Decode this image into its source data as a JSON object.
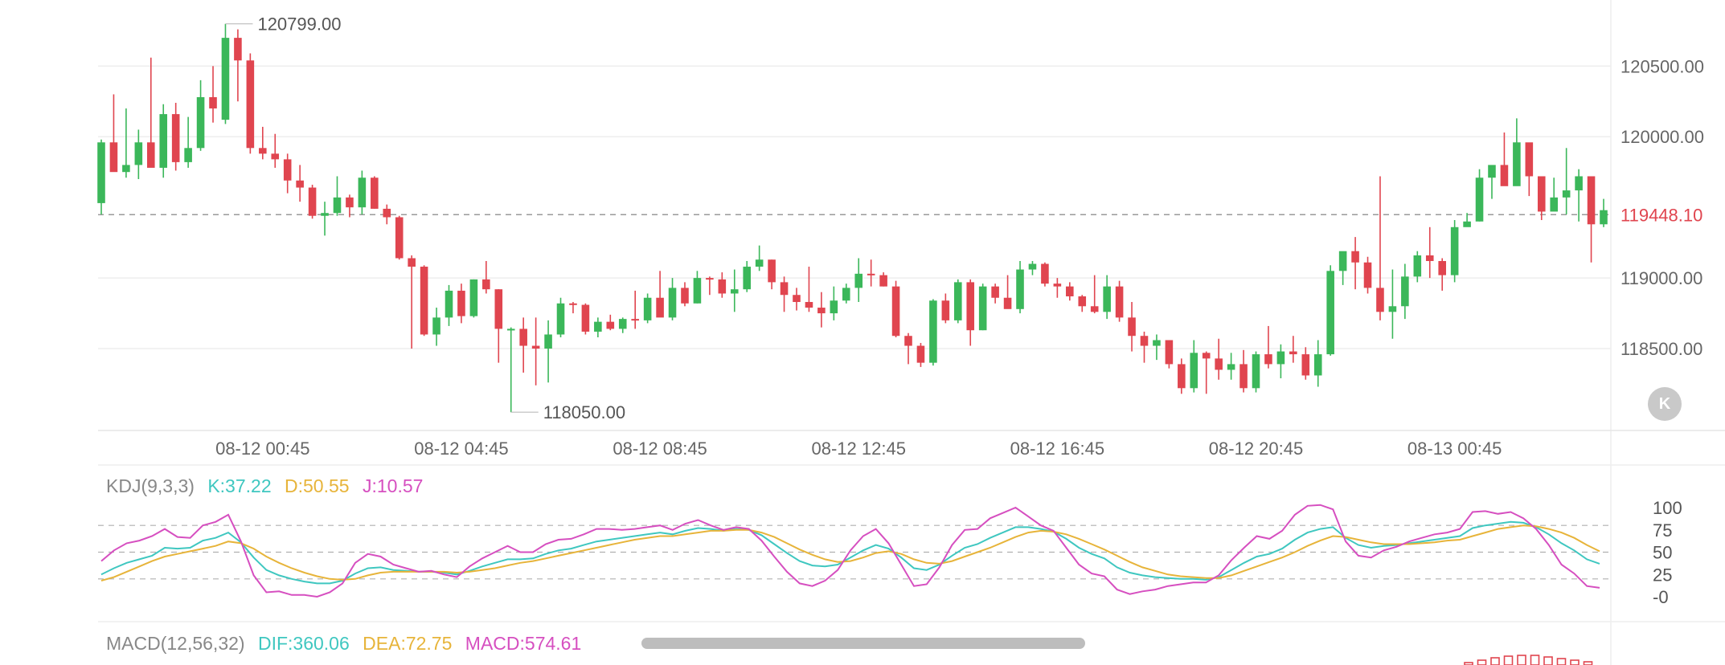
{
  "colors": {
    "up": "#3bb75a",
    "down": "#e0454f",
    "k_line": "#3fc7c0",
    "d_line": "#e7b43a",
    "j_line": "#d64fc0",
    "grid": "#eeeeee",
    "text": "#666666",
    "price_tag": "#e0454f"
  },
  "k_button": {
    "label": "K"
  },
  "chart_data": [
    {
      "type": "candlestick",
      "title": "",
      "ylim": [
        118000,
        120820
      ],
      "y_ticks": [
        "120500.00",
        "120000.00",
        "119000.00",
        "118500.00"
      ],
      "y_tick_values": [
        120500,
        120000,
        119000,
        118500
      ],
      "x_ticks": [
        "08-12 00:45",
        "08-12 04:45",
        "08-12 08:45",
        "08-12 12:45",
        "08-12 16:45",
        "08-12 20:45",
        "08-13 00:45"
      ],
      "x_tick_index": [
        13,
        29,
        45,
        61,
        77,
        93,
        109
      ],
      "current_price": {
        "label": "119448.10",
        "value": 119448.1
      },
      "annotations": [
        {
          "label": "120799.00",
          "value": 120799,
          "index": 10
        },
        {
          "label": "118050.00",
          "value": 118050,
          "index": 33
        }
      ],
      "ohlc": [
        [
          119530,
          119980,
          119450,
          119960
        ],
        [
          119960,
          120300,
          119760,
          119750
        ],
        [
          119750,
          120200,
          119710,
          119800
        ],
        [
          119800,
          120050,
          119700,
          119960
        ],
        [
          119960,
          120560,
          119800,
          119780
        ],
        [
          119780,
          120230,
          119710,
          120160
        ],
        [
          120160,
          120240,
          119760,
          119820
        ],
        [
          119820,
          120140,
          119780,
          119920
        ],
        [
          119920,
          120400,
          119900,
          120280
        ],
        [
          120280,
          120500,
          120100,
          120200
        ],
        [
          120120,
          120799,
          120090,
          120700
        ],
        [
          120700,
          120760,
          120250,
          120540
        ],
        [
          120540,
          120590,
          119880,
          119920
        ],
        [
          119920,
          120070,
          119840,
          119880
        ],
        [
          119880,
          120020,
          119780,
          119840
        ],
        [
          119840,
          119880,
          119600,
          119690
        ],
        [
          119690,
          119800,
          119540,
          119640
        ],
        [
          119640,
          119660,
          119420,
          119440
        ],
        [
          119440,
          119540,
          119300,
          119460
        ],
        [
          119460,
          119720,
          119440,
          119570
        ],
        [
          119570,
          119590,
          119430,
          119500
        ],
        [
          119500,
          119760,
          119450,
          119710
        ],
        [
          119710,
          119720,
          119490,
          119490
        ],
        [
          119490,
          119520,
          119380,
          119430
        ],
        [
          119430,
          119440,
          119130,
          119140
        ],
        [
          119140,
          119160,
          118500,
          119080
        ],
        [
          119080,
          119090,
          118590,
          118600
        ],
        [
          118600,
          118790,
          118520,
          118720
        ],
        [
          118720,
          118950,
          118660,
          118910
        ],
        [
          118910,
          118960,
          118680,
          118730
        ],
        [
          118730,
          118990,
          118720,
          118990
        ],
        [
          118990,
          119120,
          118890,
          118920
        ],
        [
          118920,
          118920,
          118400,
          118640
        ],
        [
          118640,
          118650,
          118050,
          118640
        ],
        [
          118640,
          118720,
          118330,
          118520
        ],
        [
          118520,
          118720,
          118240,
          118500
        ],
        [
          118500,
          118700,
          118260,
          118600
        ],
        [
          118600,
          118860,
          118580,
          118820
        ],
        [
          118820,
          118830,
          118750,
          118810
        ],
        [
          118810,
          118820,
          118600,
          118620
        ],
        [
          118620,
          118720,
          118580,
          118690
        ],
        [
          118690,
          118740,
          118630,
          118640
        ],
        [
          118640,
          118720,
          118610,
          118710
        ],
        [
          118710,
          118910,
          118640,
          118700
        ],
        [
          118700,
          118890,
          118680,
          118860
        ],
        [
          118860,
          119050,
          118770,
          118720
        ],
        [
          118720,
          119000,
          118700,
          118930
        ],
        [
          118930,
          118970,
          118800,
          118820
        ],
        [
          118820,
          119050,
          118820,
          119000
        ],
        [
          119000,
          119010,
          118880,
          118990
        ],
        [
          118990,
          119040,
          118860,
          118890
        ],
        [
          118890,
          119060,
          118760,
          118920
        ],
        [
          118920,
          119120,
          118900,
          119080
        ],
        [
          119080,
          119230,
          119050,
          119130
        ],
        [
          119130,
          119130,
          118920,
          118970
        ],
        [
          118970,
          119010,
          118760,
          118880
        ],
        [
          118880,
          118930,
          118770,
          118830
        ],
        [
          118830,
          119080,
          118760,
          118790
        ],
        [
          118790,
          118900,
          118650,
          118750
        ],
        [
          118750,
          118940,
          118700,
          118840
        ],
        [
          118840,
          118960,
          118820,
          118930
        ],
        [
          118930,
          119140,
          118830,
          119030
        ],
        [
          119030,
          119130,
          118940,
          119020
        ],
        [
          119020,
          119040,
          118940,
          118940
        ],
        [
          118940,
          118980,
          118580,
          118590
        ],
        [
          118590,
          118610,
          118390,
          118520
        ],
        [
          118520,
          118540,
          118370,
          118400
        ],
        [
          118400,
          118850,
          118380,
          118840
        ],
        [
          118840,
          118890,
          118680,
          118700
        ],
        [
          118700,
          118990,
          118680,
          118970
        ],
        [
          118970,
          118990,
          118520,
          118630
        ],
        [
          118630,
          118960,
          118630,
          118940
        ],
        [
          118940,
          118960,
          118820,
          118860
        ],
        [
          118860,
          119020,
          118800,
          118780
        ],
        [
          118780,
          119120,
          118750,
          119060
        ],
        [
          119060,
          119120,
          119020,
          119100
        ],
        [
          119100,
          119110,
          118940,
          118960
        ],
        [
          118960,
          119000,
          118860,
          118940
        ],
        [
          118940,
          118970,
          118840,
          118870
        ],
        [
          118870,
          118880,
          118760,
          118800
        ],
        [
          118800,
          119020,
          118750,
          118760
        ],
        [
          118760,
          119020,
          118710,
          118940
        ],
        [
          118940,
          118980,
          118690,
          118720
        ],
        [
          118720,
          118830,
          118480,
          118590
        ],
        [
          118590,
          118620,
          118400,
          118520
        ],
        [
          118520,
          118600,
          118420,
          118560
        ],
        [
          118560,
          118560,
          118360,
          118390
        ],
        [
          118390,
          118430,
          118180,
          118220
        ],
        [
          118220,
          118560,
          118190,
          118470
        ],
        [
          118470,
          118480,
          118180,
          118430
        ],
        [
          118430,
          118570,
          118280,
          118350
        ],
        [
          118350,
          118470,
          118280,
          118390
        ],
        [
          118390,
          118490,
          118190,
          118220
        ],
        [
          118220,
          118480,
          118190,
          118460
        ],
        [
          118460,
          118660,
          118360,
          118390
        ],
        [
          118390,
          118530,
          118290,
          118480
        ],
        [
          118480,
          118590,
          118400,
          118460
        ],
        [
          118460,
          118510,
          118280,
          118310
        ],
        [
          118310,
          118560,
          118230,
          118460
        ],
        [
          118460,
          119090,
          118450,
          119050
        ],
        [
          119050,
          119150,
          118950,
          119190
        ],
        [
          119190,
          119290,
          118920,
          119110
        ],
        [
          119110,
          119150,
          118890,
          118930
        ],
        [
          118930,
          119720,
          118700,
          118760
        ],
        [
          118760,
          119060,
          118570,
          118800
        ],
        [
          118800,
          119100,
          118710,
          119010
        ],
        [
          119010,
          119190,
          118970,
          119160
        ],
        [
          119160,
          119360,
          119000,
          119120
        ],
        [
          119120,
          119140,
          118910,
          119020
        ],
        [
          119020,
          119410,
          118970,
          119360
        ],
        [
          119360,
          119460,
          119370,
          119400
        ],
        [
          119400,
          119770,
          119400,
          119710
        ],
        [
          119710,
          119750,
          119560,
          119800
        ],
        [
          119800,
          120030,
          119680,
          119650
        ],
        [
          119650,
          120130,
          119770,
          119960
        ],
        [
          119960,
          119910,
          119580,
          119720
        ],
        [
          119720,
          119700,
          119410,
          119470
        ],
        [
          119470,
          119710,
          119500,
          119570
        ],
        [
          119570,
          119920,
          119450,
          119620
        ],
        [
          119620,
          119770,
          119400,
          119720
        ],
        [
          119720,
          119710,
          119110,
          119380
        ],
        [
          119380,
          119560,
          119360,
          119480
        ]
      ]
    },
    {
      "type": "line",
      "title": "",
      "indicator": "KDJ(9,3,3)",
      "readout": {
        "k": "K:37.22",
        "d": "D:50.55",
        "j": "J:10.57"
      },
      "ylim": [
        -10,
        110
      ],
      "y_ticks": [
        "100",
        "75",
        "50",
        "25",
        "-0"
      ],
      "y_tick_values": [
        100,
        75,
        50,
        25,
        0
      ],
      "reference_lines": [
        80,
        50,
        20
      ],
      "series": [
        {
          "name": "K",
          "values": [
            25,
            32,
            38,
            42,
            46,
            55,
            54,
            55,
            63,
            66,
            72,
            61,
            44,
            30,
            24,
            20,
            17,
            15,
            15,
            18,
            26,
            32,
            33,
            30,
            29,
            28,
            28,
            27,
            25,
            29,
            34,
            38,
            42,
            42,
            43,
            48,
            52,
            54,
            58,
            62,
            64,
            66,
            68,
            70,
            72,
            70,
            74,
            77,
            76,
            74,
            76,
            75,
            69,
            59,
            49,
            40,
            35,
            34,
            36,
            44,
            52,
            58,
            54,
            44,
            32,
            30,
            36,
            46,
            55,
            59,
            66,
            72,
            78,
            78,
            76,
            73,
            65,
            55,
            48,
            43,
            33,
            27,
            24,
            22,
            21,
            20,
            20,
            19,
            22,
            30,
            38,
            45,
            48,
            54,
            64,
            72,
            76,
            78,
            66,
            58,
            55,
            57,
            58,
            60,
            62,
            64,
            66,
            68,
            77,
            80,
            82,
            84,
            83,
            78,
            70,
            60,
            52,
            42,
            37
          ]
        },
        {
          "name": "D",
          "values": [
            18,
            22,
            28,
            34,
            40,
            45,
            48,
            51,
            54,
            57,
            62,
            60,
            54,
            45,
            38,
            32,
            27,
            23,
            20,
            19,
            20,
            24,
            27,
            28,
            28,
            28,
            28,
            28,
            27,
            28,
            30,
            32,
            35,
            38,
            40,
            43,
            46,
            49,
            52,
            55,
            58,
            61,
            64,
            66,
            68,
            68,
            70,
            72,
            74,
            74,
            75,
            75,
            72,
            67,
            60,
            53,
            47,
            42,
            39,
            40,
            44,
            49,
            51,
            48,
            42,
            38,
            37,
            40,
            45,
            50,
            55,
            61,
            67,
            72,
            74,
            73,
            70,
            65,
            59,
            53,
            46,
            39,
            33,
            29,
            25,
            23,
            22,
            21,
            21,
            24,
            29,
            34,
            39,
            44,
            50,
            57,
            63,
            68,
            67,
            64,
            61,
            59,
            59,
            59,
            60,
            61,
            63,
            64,
            68,
            72,
            76,
            78,
            80,
            79,
            76,
            72,
            66,
            58,
            51
          ]
        },
        {
          "name": "J",
          "values": [
            40,
            52,
            60,
            63,
            68,
            76,
            67,
            66,
            80,
            84,
            92,
            62,
            24,
            5,
            6,
            2,
            2,
            0,
            5,
            15,
            38,
            48,
            45,
            36,
            32,
            28,
            29,
            25,
            22,
            34,
            43,
            50,
            57,
            50,
            50,
            59,
            64,
            65,
            70,
            76,
            76,
            75,
            76,
            78,
            80,
            75,
            82,
            86,
            80,
            75,
            78,
            76,
            63,
            45,
            28,
            15,
            12,
            18,
            30,
            52,
            68,
            76,
            60,
            36,
            12,
            14,
            33,
            58,
            75,
            76,
            88,
            94,
            100,
            90,
            80,
            74,
            55,
            36,
            26,
            23,
            8,
            3,
            6,
            8,
            12,
            14,
            16,
            16,
            24,
            41,
            55,
            68,
            65,
            74,
            92,
            102,
            103,
            98,
            62,
            46,
            44,
            52,
            56,
            62,
            66,
            70,
            72,
            76,
            95,
            96,
            93,
            95,
            88,
            76,
            58,
            36,
            26,
            12,
            10
          ]
        }
      ]
    },
    {
      "type": "bar",
      "title": "",
      "indicator": "MACD(12,56,32)",
      "readout": {
        "dif": "DIF:360.06",
        "dea": "DEA:72.75",
        "macd": "MACD:574.61"
      }
    }
  ]
}
